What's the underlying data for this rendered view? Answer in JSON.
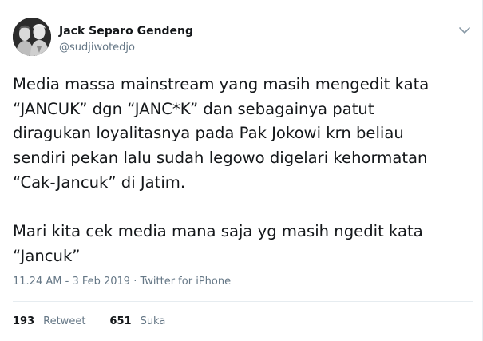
{
  "author": {
    "name": "Jack Separo Gendeng",
    "handle": "@sudjiwotedjo"
  },
  "tweet": {
    "text": "Media massa mainstream yang masih mengedit kata\n“JANCUK” dgn “JANC*K” dan sebagainya patut\ndiragukan loyalitasnya pada Pak Jokowi krn beliau\nsendiri pekan lalu sudah legowo digelari kehormatan\n“Cak-Jancuk” di Jatim.\n\nMari kita cek media mana saja yg masih ngedit kata\n“Jancuk”",
    "time": "11.24 AM",
    "date": "3 Feb 2019",
    "separator": " · ",
    "source": "Twitter for iPhone"
  },
  "stats": {
    "retweets_count": "193",
    "retweets_label": "Retweet",
    "likes_count": "651",
    "likes_label": "Suka"
  },
  "icons": {
    "more": "chevron-down-icon"
  },
  "colors": {
    "text": "#14171a",
    "secondary": "#657786",
    "divider": "#e6ecf0"
  }
}
